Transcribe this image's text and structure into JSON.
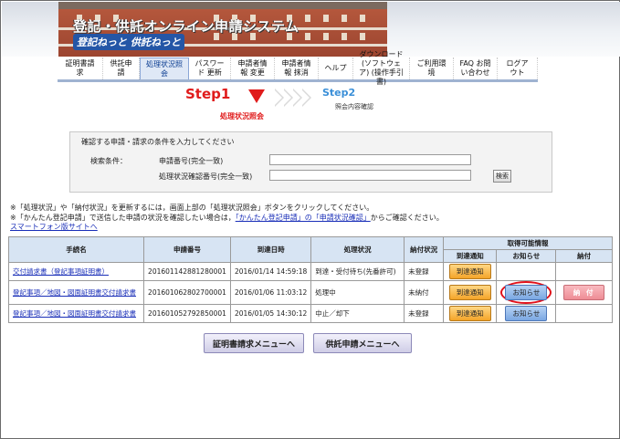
{
  "header": {
    "title": "登記・供託オンライン申請システム",
    "subtitle": "登記ねっと 供託ねっと"
  },
  "nav": [
    {
      "label": "証明書請求",
      "active": false
    },
    {
      "label": "供託申請",
      "active": false
    },
    {
      "label": "処理状況照会",
      "active": true
    },
    {
      "label": "パスワード 更新",
      "active": false
    },
    {
      "label": "申請者情報 変更",
      "active": false
    },
    {
      "label": "申請者情報 抹消",
      "active": false
    },
    {
      "label": "ヘルプ",
      "active": false
    },
    {
      "label": "ダウンロード (ソフトウェア) (操作手引書)",
      "active": false
    },
    {
      "label": "ご利用環境",
      "active": false
    },
    {
      "label": "FAQ お問い合わせ",
      "active": false
    },
    {
      "label": "ログアウト",
      "active": false
    }
  ],
  "steps": {
    "step1_label": "Step1",
    "step1_caption": "処理状況照会",
    "step2_label": "Step2",
    "step2_caption": "照会内容確認"
  },
  "search": {
    "lead": "確認する申請・請求の条件を入力してください",
    "condition_label": "検索条件：",
    "field1_label": "申請番号(完全一致)",
    "field1_value": "",
    "field2_label": "処理状況確認番号(完全一致)",
    "field2_value": "",
    "button_label": "検索"
  },
  "notes": {
    "line1": "※「処理状況」や「納付状況」を更新するには，画面上部の「処理状況照会」ボタンをクリックしてください。",
    "line2_prefix": "※「かんたん登記申請」で送信した申請の状況を確認したい場合は，",
    "line2_link": "「かんたん登記申請」の「申請状況確認」",
    "line2_suffix": "からご確認ください。",
    "smartphone_link": "スマートフォン版サイトへ"
  },
  "table": {
    "headers": {
      "procedure": "手続名",
      "app_no": "申請番号",
      "arrival": "到達日時",
      "status": "処理状況",
      "payment": "納付状況",
      "available": "取得可能情報",
      "arrival_notice": "到達通知",
      "notice": "お知らせ",
      "pay": "納付"
    },
    "rows": [
      {
        "procedure": "交付請求書（登記事項証明書）",
        "app_no": "201601142881280001",
        "arrival": "2016/01/14 14:59:18",
        "status": "到達・受付待ち(先番許可)",
        "payment": "未登録",
        "arrival_notice": "到達通知",
        "notice": "",
        "pay": ""
      },
      {
        "procedure": "登記事項／地図・図面証明書交付請求書",
        "app_no": "201601062802700001",
        "arrival": "2016/01/06 11:03:12",
        "status": "処理中",
        "payment": "未納付",
        "arrival_notice": "到達通知",
        "notice": "お知らせ",
        "pay": "納 付"
      },
      {
        "procedure": "登記事項／地図・図面証明書交付請求書",
        "app_no": "201601052792850001",
        "arrival": "2016/01/05 14:30:12",
        "status": "中止／却下",
        "payment": "未登録",
        "arrival_notice": "到達通知",
        "notice": "お知らせ",
        "pay": ""
      }
    ]
  },
  "bottom": {
    "cert_menu": "証明書請求メニューへ",
    "deposit_menu": "供託申請メニューへ"
  }
}
